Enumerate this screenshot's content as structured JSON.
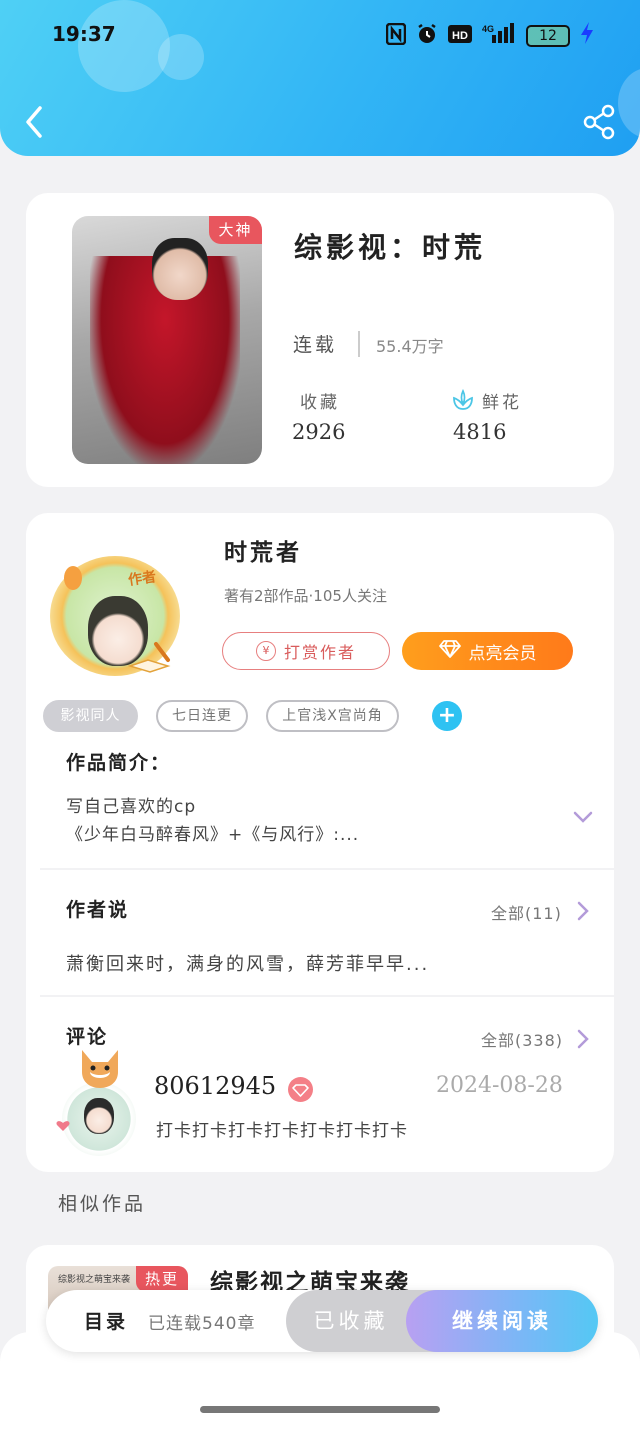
{
  "status_bar": {
    "time": "19:37",
    "icons": [
      "nfc-icon",
      "alarm-icon",
      "hd-icon",
      "signal-4g-icon"
    ],
    "hd_text": "HD",
    "network_text": "4G",
    "battery": "12"
  },
  "nav": {
    "back_icon": "chevron-left-icon",
    "share_icon": "share-icon"
  },
  "book": {
    "title": "综影视：时荒",
    "badge": "大神",
    "status": "连载",
    "words": "55.4万字",
    "favorites_label": "收藏",
    "favorites_value": "2926",
    "flowers_label": "鲜花",
    "flowers_value": "4816"
  },
  "author": {
    "badge": "作者",
    "name": "时荒者",
    "info": "著有2部作品·105人关注",
    "reward_button": "打赏作者",
    "reward_symbol": "¥",
    "vip_button": "点亮会员"
  },
  "tags": [
    "影视同人",
    "七日连更",
    "上官浅X宫尚角"
  ],
  "tag_add": "+",
  "intro": {
    "title": "作品简介：",
    "line1": "写自己喜欢的cp",
    "line2": "《少年白马醉春风》+《与风行》:..."
  },
  "author_says": {
    "title": "作者说",
    "more": "全部(11)",
    "text": "萧衡回来时，满身的风雪，薛芳菲早早..."
  },
  "comments": {
    "title": "评论",
    "more": "全部(338)",
    "user": "80612945",
    "date": "2024-08-28",
    "text": "打卡打卡打卡打卡打卡打卡打卡"
  },
  "similar": {
    "title": "相似作品",
    "book_title": "综影视之萌宝来袭",
    "badge": "热更",
    "cover_text": "综影视之萌宝来袭"
  },
  "bottom": {
    "toc": "目录",
    "chapters": "已连载540章",
    "collected": "已收藏",
    "continue": "继续阅读"
  },
  "colors": {
    "header_start": "#4fd0f5",
    "header_end": "#1f9ff2",
    "badge_red": "#e8565e",
    "vip_orange": "#ff8a1a",
    "accent_purple": "#b39bd9"
  }
}
